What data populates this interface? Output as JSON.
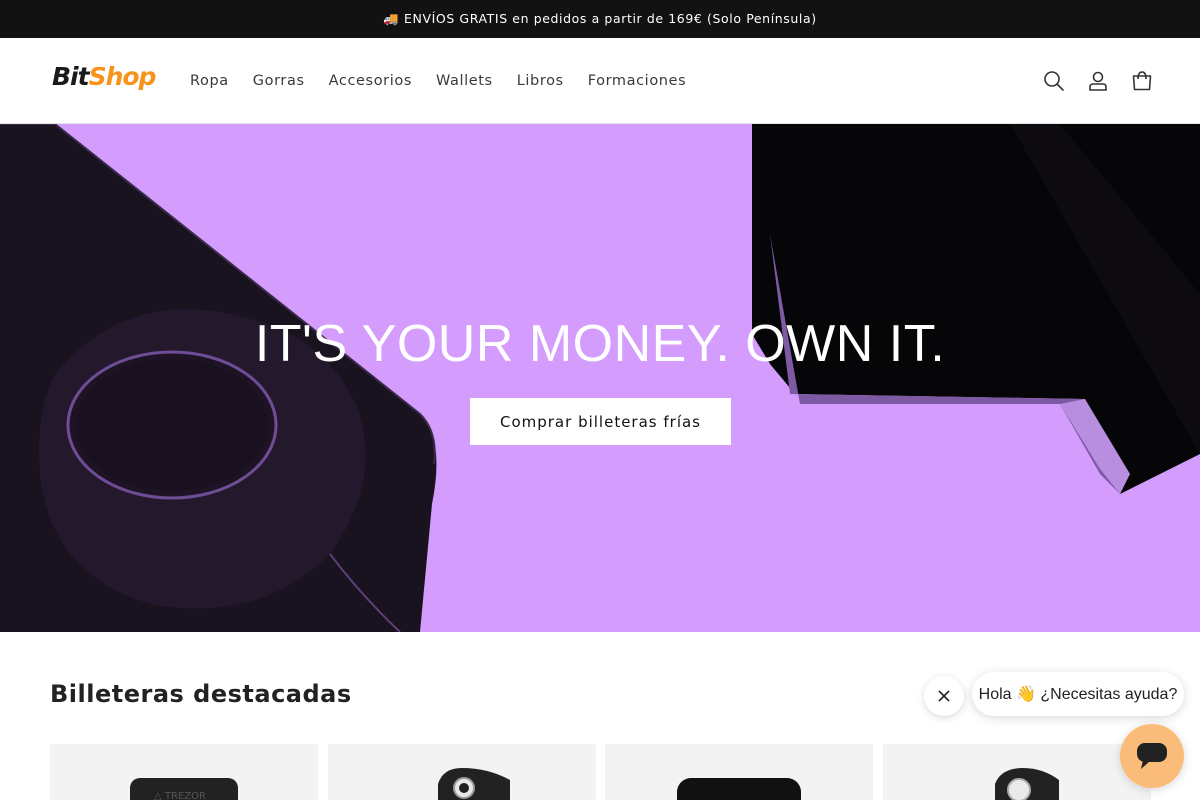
{
  "announcement": {
    "icon": "truck-emoji",
    "text": "🚚 ENVÍOS GRATIS en pedidos a partir de 169€ (Solo Península)"
  },
  "header": {
    "logo_part1": "Bit",
    "logo_part2": "Shop",
    "nav": [
      "Ropa",
      "Gorras",
      "Accesorios",
      "Wallets",
      "Libros",
      "Formaciones"
    ],
    "icons": [
      "search-icon",
      "account-icon",
      "cart-icon"
    ]
  },
  "hero": {
    "title": "IT'S YOUR MONEY. OWN IT.",
    "button_label": "Comprar billeteras frías",
    "background_color": "#d49cfc"
  },
  "featured": {
    "title": "Billeteras destacadas",
    "products": [
      {
        "image": "trezor-wallet-image"
      },
      {
        "image": "white-black-wallet-image"
      },
      {
        "image": "black-wallet-image"
      },
      {
        "image": "white-black-wallet-image-2"
      }
    ]
  },
  "chat": {
    "greeting": "Hola 👋 ¿Necesitas ayuda?",
    "accent_color": "#fbbc7a"
  },
  "colors": {
    "brand_orange": "#f7931a",
    "announcement_bg": "#121212"
  }
}
